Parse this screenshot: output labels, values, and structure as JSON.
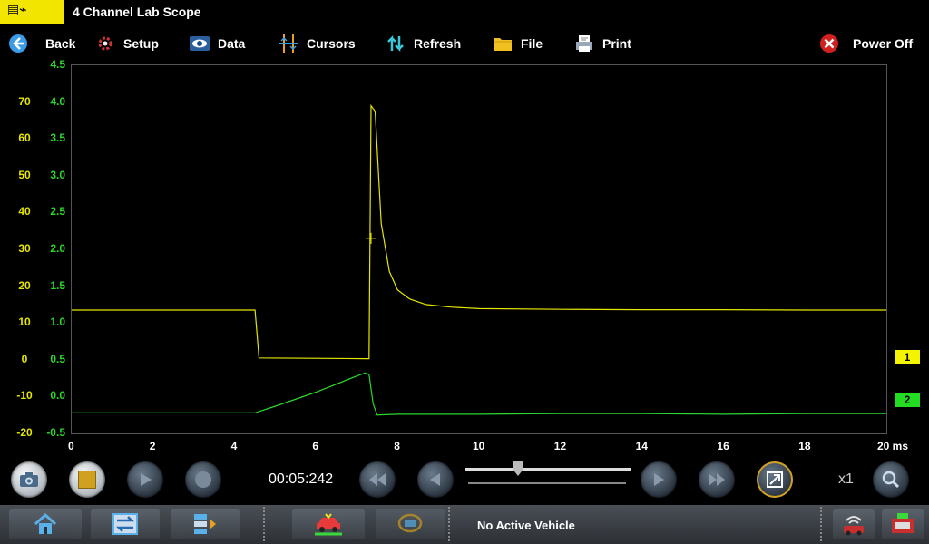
{
  "titlebar": {
    "title": "4 Channel Lab Scope"
  },
  "toolbar": {
    "back": "Back",
    "setup": "Setup",
    "data": "Data",
    "cursors": "Cursors",
    "refresh": "Refresh",
    "file": "File",
    "print": "Print",
    "power_off": "Power Off"
  },
  "colors": {
    "channel1": "#e6e600",
    "channel2": "#2bd82b"
  },
  "chart_data": {
    "type": "line",
    "xlabel": "ms",
    "xlim": [
      0,
      20
    ],
    "x_ticks": [
      "0",
      "2",
      "4",
      "6",
      "8",
      "10",
      "12",
      "14",
      "16",
      "18",
      "20 ms"
    ],
    "axis_ch1_ticks": [
      "70",
      "60",
      "50",
      "40",
      "30",
      "20",
      "10",
      "0",
      "-10",
      "-20"
    ],
    "axis_ch1_range": [
      -20,
      80
    ],
    "axis_ch2_ticks": [
      "4.5",
      "4.0",
      "3.5",
      "3.0",
      "2.5",
      "2.0",
      "1.5",
      "1.0",
      "0.5",
      "0.0",
      "-0.5"
    ],
    "axis_ch2_range": [
      -0.5,
      4.5
    ],
    "series": [
      {
        "name": "1",
        "axis": "ch1",
        "x": [
          0,
          4.5,
          4.5,
          4.6,
          7.2,
          7.3,
          7.35,
          7.45,
          7.6,
          7.8,
          8.0,
          8.3,
          8.7,
          9.3,
          10,
          12,
          14,
          16,
          18,
          20
        ],
        "y": [
          13.5,
          13.5,
          13.5,
          0.5,
          0.3,
          0.3,
          69,
          67.5,
          37,
          24,
          19,
          16.5,
          15,
          14.3,
          13.9,
          13.7,
          13.6,
          13.6,
          13.5,
          13.5
        ]
      },
      {
        "name": "2",
        "axis": "ch2",
        "x": [
          0,
          4.5,
          5.0,
          6.0,
          7.0,
          7.2,
          7.3,
          7.4,
          7.5,
          8,
          10,
          12,
          14,
          16,
          18,
          20
        ],
        "y": [
          -0.22,
          -0.22,
          -0.13,
          0.06,
          0.28,
          0.32,
          0.3,
          -0.1,
          -0.25,
          -0.24,
          -0.24,
          -0.23,
          -0.23,
          -0.24,
          -0.23,
          -0.23
        ]
      }
    ],
    "cursor": {
      "x": 7.35,
      "y_ch1": 33
    },
    "grid": false
  },
  "channels": {
    "ch1_label": "1",
    "ch2_label": "2"
  },
  "playback": {
    "time": "00:05:242",
    "zoom": "x1"
  },
  "status": {
    "vehicle": "No Active Vehicle"
  }
}
